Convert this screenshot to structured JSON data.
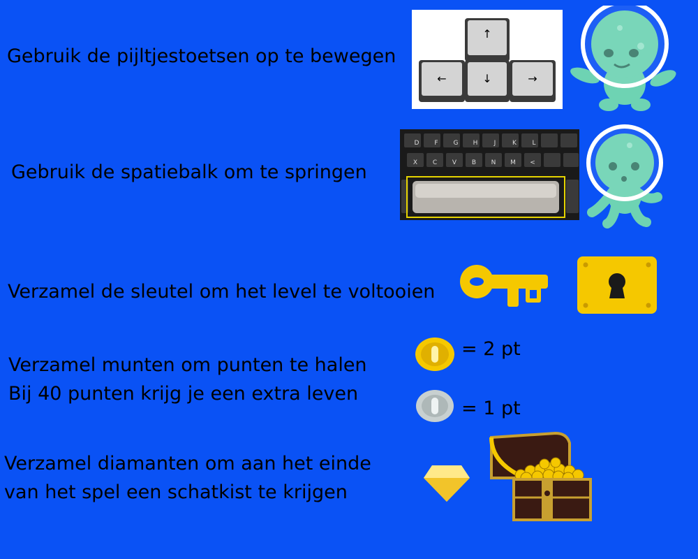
{
  "instructions": {
    "move": "Gebruik de pijltjestoetsen op te bewegen",
    "jump": "Gebruik de spatiebalk om te springen",
    "key": "Verzamel de sleutel om het level te voltooien",
    "coins_line1": "Verzamel munten om punten te halen",
    "coins_line2": "Bij 40 punten krijg je een extra leven",
    "diamonds_line1": "Verzamel diamanten om aan het einde",
    "diamonds_line2": "van het spel een schatkist te krijgen"
  },
  "coin_values": {
    "gold": "= 2 pt",
    "silver": "= 1 pt"
  },
  "keyboard_keys": {
    "up": "↑",
    "down": "↓",
    "left": "←",
    "right": "→",
    "row1": [
      "D",
      "F",
      "G",
      "H",
      "J",
      "K",
      "L"
    ],
    "row2": [
      "X",
      "C",
      "V",
      "B",
      "N",
      "M",
      "<"
    ]
  },
  "colors": {
    "background": "#0a52f5",
    "alien": "#6ed3b3",
    "gold": "#f5c800",
    "silver": "#c8d0d0"
  }
}
